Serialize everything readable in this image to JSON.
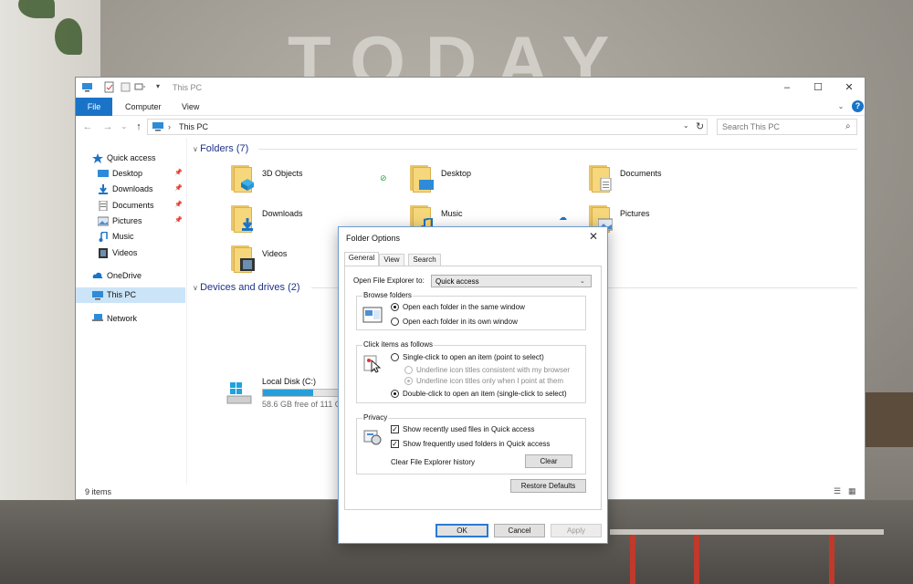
{
  "explorer": {
    "title": "This PC",
    "ribbon_tabs": [
      "File",
      "Computer",
      "View"
    ],
    "address": "This PC",
    "search_placeholder": "Search This PC",
    "nav": [
      {
        "label": "Quick access",
        "icon": "star-icon"
      },
      {
        "label": "Desktop",
        "icon": "desktop-icon",
        "pinned": true
      },
      {
        "label": "Downloads",
        "icon": "download-icon",
        "pinned": true
      },
      {
        "label": "Documents",
        "icon": "documents-icon",
        "pinned": true
      },
      {
        "label": "Pictures",
        "icon": "pictures-icon",
        "pinned": true
      },
      {
        "label": "Music",
        "icon": "music-icon"
      },
      {
        "label": "Videos",
        "icon": "videos-icon"
      },
      {
        "label": "OneDrive",
        "icon": "onedrive-icon"
      },
      {
        "label": "This PC",
        "icon": "this-pc-icon",
        "selected": true
      },
      {
        "label": "Network",
        "icon": "network-icon"
      }
    ],
    "folders_header": "Folders (7)",
    "folders": [
      "3D Objects",
      "Desktop",
      "Documents",
      "Downloads",
      "Music",
      "Pictures",
      "Videos"
    ],
    "devices_header": "Devices and drives (2)",
    "drive": {
      "name": "Local Disk (C:)",
      "free": "58.6 GB free of 111 GB",
      "used_fraction": 0.47
    },
    "status": "9 items",
    "accent_color": "#1a73c7"
  },
  "dialog": {
    "title": "Folder Options",
    "tabs": [
      "General",
      "View",
      "Search"
    ],
    "open_label": "Open File Explorer to:",
    "open_value": "Quick access",
    "browse": {
      "title": "Browse folders",
      "opt_same": "Open each folder in the same window",
      "opt_own": "Open each folder in its own window"
    },
    "click": {
      "title": "Click items as follows",
      "single": "Single-click to open an item (point to select)",
      "underline_browser": "Underline icon titles consistent with my browser",
      "underline_point": "Underline icon titles only when I point at them",
      "double": "Double-click to open an item (single-click to select)"
    },
    "privacy": {
      "title": "Privacy",
      "recent_files": "Show recently used files in Quick access",
      "frequent_folders": "Show frequently used folders in Quick access",
      "clear_history": "Clear File Explorer history",
      "clear_btn": "Clear"
    },
    "restore_btn": "Restore Defaults",
    "ok": "OK",
    "cancel": "Cancel",
    "apply": "Apply"
  }
}
